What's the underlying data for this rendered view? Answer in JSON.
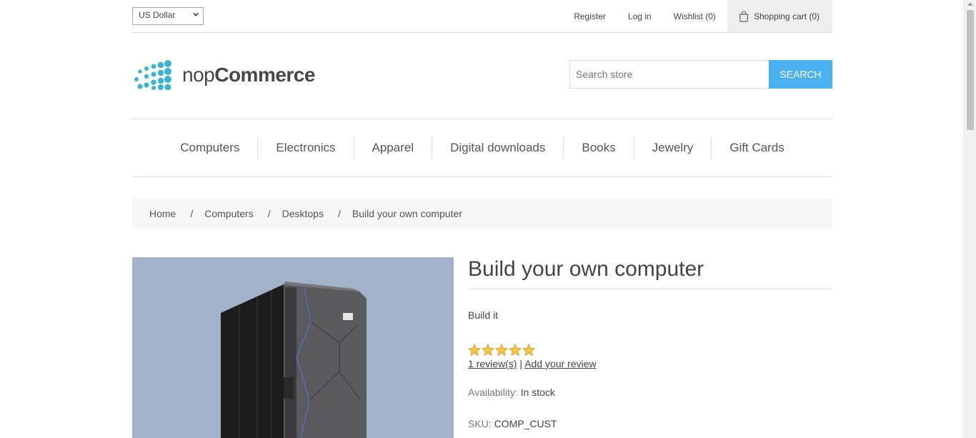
{
  "header": {
    "currency": "US Dollar",
    "links": {
      "register": "Register",
      "login": "Log in",
      "wishlist": "Wishlist (0)",
      "cart": "Shopping cart (0)"
    }
  },
  "logo": {
    "prefix": "nop",
    "brand": "Commerce"
  },
  "search": {
    "placeholder": "Search store",
    "button": "Search"
  },
  "menu": [
    "Computers",
    "Electronics",
    "Apparel",
    "Digital downloads",
    "Books",
    "Jewelry",
    "Gift Cards"
  ],
  "breadcrumb": {
    "items": [
      "Home",
      "Computers",
      "Desktops"
    ],
    "separator": "/",
    "current": "Build your own computer"
  },
  "product": {
    "title": "Build your own computer",
    "short_description": "Build it",
    "rating": 5,
    "rating_max": 5,
    "reviews_link": "1 review(s)",
    "review_separator": "|",
    "add_review_link": "Add your review",
    "availability_label": "Availability:",
    "availability_value": "In stock",
    "sku_label": "SKU:",
    "sku_value": "COMP_CUST",
    "image_bg_color": "#a2b2cb"
  },
  "colors": {
    "accent": "#4ab2f1",
    "logo_dots": "#37b5d3",
    "star": "#f5c542"
  }
}
